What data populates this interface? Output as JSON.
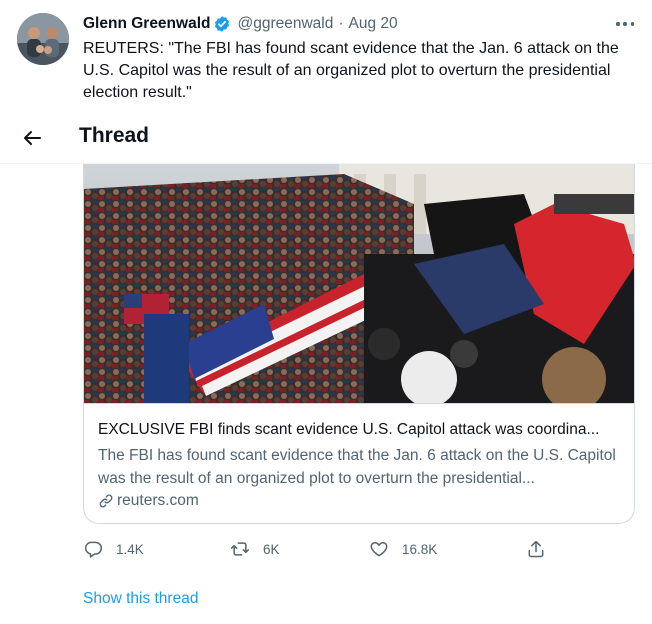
{
  "tweet": {
    "author_name": "Glenn Greenwald",
    "handle": "@ggreenwald",
    "separator": "·",
    "timestamp": "Aug 20",
    "text": "REUTERS: \"The FBI has found scant evidence that the Jan. 6 attack on the U.S. Capitol was the result of an organized plot to overturn the presidential election result.\""
  },
  "thread_header": {
    "title": "Thread"
  },
  "card": {
    "title": "EXCLUSIVE FBI finds scant evidence U.S. Capitol attack was coordina...",
    "description": "The FBI has found scant evidence that the Jan. 6 attack on the U.S. Capitol was the result of an organized plot to overturn the presidential...",
    "domain": "reuters.com"
  },
  "actions": {
    "replies": "1.4K",
    "retweets": "6K",
    "likes": "16.8K"
  },
  "show_thread_label": "Show this thread",
  "icons": {
    "verified": "verified-badge-icon",
    "more": "more-options-icon",
    "back": "back-arrow-icon",
    "link": "link-icon",
    "reply": "reply-icon",
    "retweet": "retweet-icon",
    "like": "heart-icon",
    "share": "share-icon"
  },
  "colors": {
    "accent": "#1d9bf0",
    "text_primary": "#0f1419",
    "text_secondary": "#536471",
    "border": "#cfd9de"
  }
}
